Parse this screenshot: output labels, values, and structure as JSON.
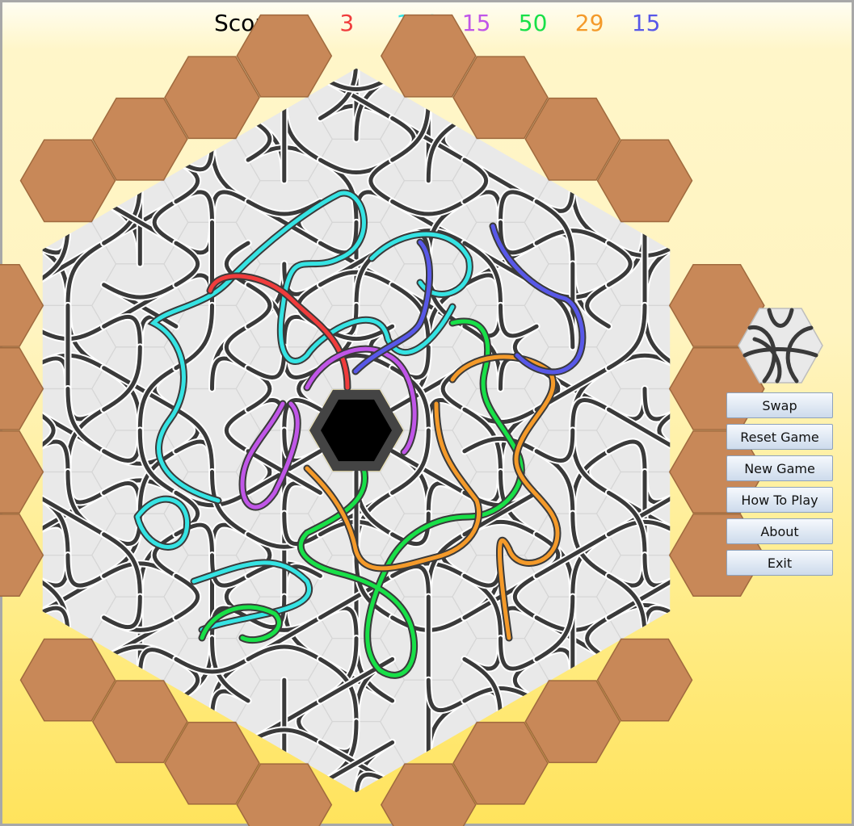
{
  "scores": {
    "label": "Scores :",
    "entries": [
      {
        "value": "3",
        "color": "#f03c3c"
      },
      {
        "value": "110",
        "color": "#35e3e3"
      },
      {
        "value": "15",
        "color": "#c056e8"
      },
      {
        "value": "50",
        "color": "#18e048"
      },
      {
        "value": "29",
        "color": "#f49a2a"
      },
      {
        "value": "15",
        "color": "#5858e8"
      }
    ]
  },
  "board": {
    "border_tile_color": "#c88858",
    "play_tile_color": "#e9e9e9",
    "track_color": "#3a3a3a",
    "center_tile_color": "#000000"
  },
  "buttons": {
    "swap": "Swap",
    "reset": "Reset Game",
    "new_game": "New Game",
    "how_to_play": "How To Play",
    "about": "About",
    "exit": "Exit"
  }
}
